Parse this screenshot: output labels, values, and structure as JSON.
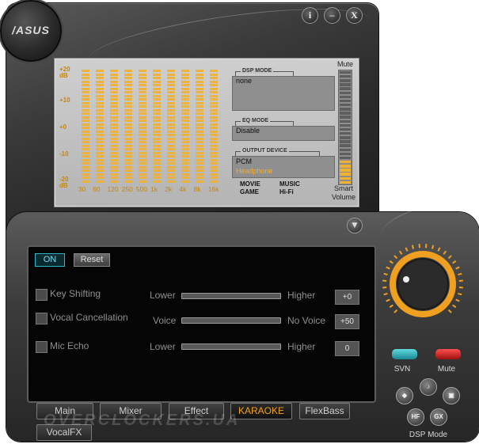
{
  "window": {
    "logo_text": "/ASUS",
    "info_button": "i",
    "minimize_button": "–",
    "close_button": "X"
  },
  "display": {
    "db_labels": [
      "+20 dB",
      "+10",
      "+0",
      "-10",
      "-20 dB"
    ],
    "freq_labels": [
      "30",
      "60",
      "120",
      "250",
      "500",
      "1k",
      "2k",
      "4k",
      "8k",
      "16k"
    ],
    "eq_bar_levels": [
      0.5,
      0.5,
      0.5,
      0.5,
      0.5,
      0.5,
      0.5,
      0.5,
      0.5,
      0.5
    ],
    "dsp_mode_label": "DSP MODE",
    "dsp_mode_value": "none",
    "eq_mode_label": "EQ MODE",
    "eq_mode_value": "Disable",
    "output_device_label": "OUTPUT DEVICE",
    "output_device_values": [
      "PCM",
      "Headphone"
    ],
    "mode_buttons": [
      "MOVIE",
      "MUSIC",
      "GAME",
      "Hi-Fi"
    ],
    "mute_label": "Mute",
    "smart_volume_label": [
      "Smart",
      "Volume"
    ],
    "volume_level": 0.2
  },
  "controls": {
    "on_button": "ON",
    "reset_button": "Reset",
    "rows": [
      {
        "label": "Key Shifting",
        "left": "Lower",
        "right": "Higher",
        "value": "+0"
      },
      {
        "label": "Vocal Cancellation",
        "left": "Voice",
        "right": "No Voice",
        "value": "+50"
      },
      {
        "label": "Mic Echo",
        "left": "Lower",
        "right": "Higher",
        "value": "0"
      }
    ]
  },
  "tabs": [
    "Main",
    "Mixer",
    "Effect",
    "KARAOKE",
    "FlexBass",
    "VocalFX"
  ],
  "active_tab": "KARAOKE",
  "right_controls": {
    "svn_label": "SVN",
    "mute_label": "Mute",
    "dsp_mode_label": "DSP Mode",
    "dsp_buttons": [
      "",
      "",
      "",
      "HF",
      "GX"
    ]
  },
  "watermark": "OVERCLOCKERS.UA",
  "colors": {
    "accent_orange": "#f0a020",
    "eq_bar": "#f0b030",
    "svn_teal": "#35b8c0",
    "mute_red": "#d02020"
  }
}
